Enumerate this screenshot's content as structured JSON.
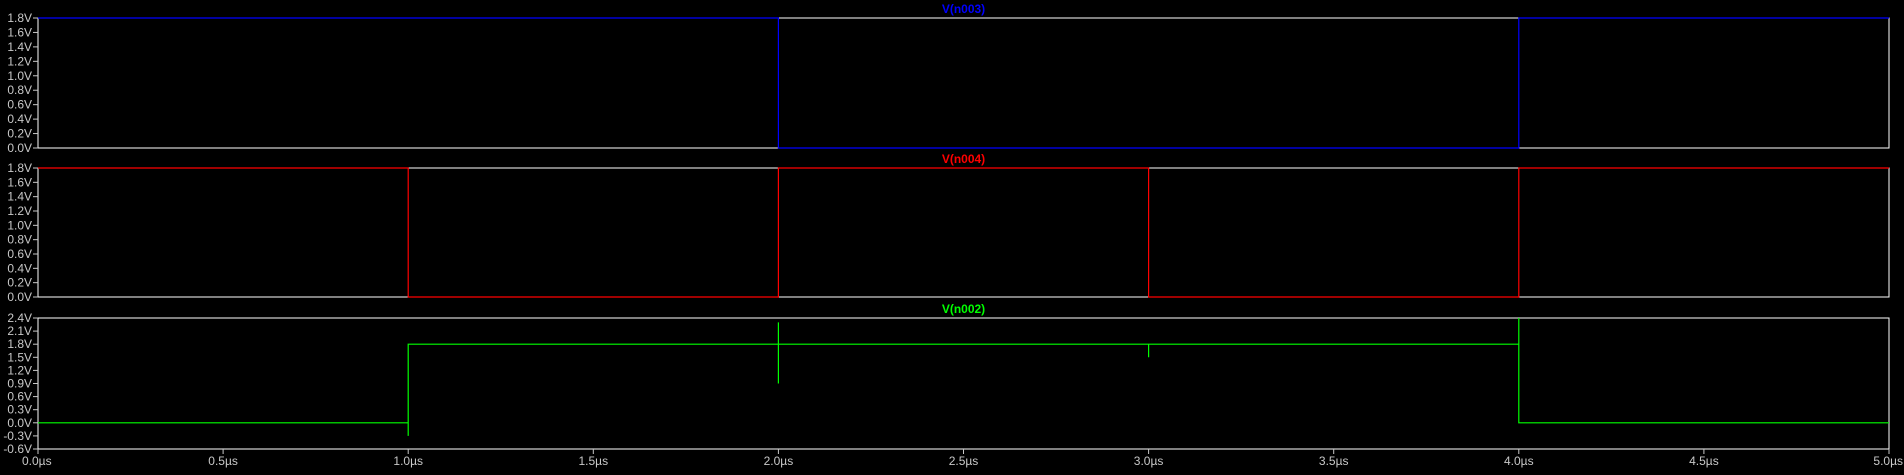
{
  "chart_data": [
    {
      "type": "line",
      "title": "V(n003)",
      "color": "#0000ff",
      "xlim": [
        0,
        5
      ],
      "ylim": [
        0,
        1.8
      ],
      "xunit": "µs",
      "yticks": [
        "0.0V",
        "0.2V",
        "0.4V",
        "0.6V",
        "0.8V",
        "1.0V",
        "1.2V",
        "1.4V",
        "1.6V",
        "1.8V"
      ],
      "x": [
        0,
        2,
        2,
        4,
        4,
        5
      ],
      "y": [
        1.8,
        1.8,
        0,
        0,
        1.8,
        1.8
      ]
    },
    {
      "type": "line",
      "title": "V(n004)",
      "color": "#ff0000",
      "xlim": [
        0,
        5
      ],
      "ylim": [
        0,
        1.8
      ],
      "xunit": "µs",
      "yticks": [
        "0.0V",
        "0.2V",
        "0.4V",
        "0.6V",
        "0.8V",
        "1.0V",
        "1.2V",
        "1.4V",
        "1.6V",
        "1.8V"
      ],
      "x": [
        0,
        1,
        1,
        2,
        2,
        3,
        3,
        4,
        4,
        5
      ],
      "y": [
        1.8,
        1.8,
        0,
        0,
        1.8,
        1.8,
        0,
        0,
        1.8,
        1.8
      ]
    },
    {
      "type": "line",
      "title": "V(n002)",
      "color": "#00ff00",
      "xlim": [
        0,
        5
      ],
      "ylim": [
        -0.6,
        2.4
      ],
      "xunit": "µs",
      "yticks": [
        "-0.6V",
        "-0.3V",
        "0.0V",
        "0.3V",
        "0.6V",
        "0.9V",
        "1.2V",
        "1.5V",
        "1.8V",
        "2.1V",
        "2.4V"
      ],
      "x": [
        0,
        1,
        1,
        1,
        2,
        2,
        2,
        2,
        3,
        3,
        3,
        4,
        4,
        4,
        4,
        5
      ],
      "y": [
        0,
        0,
        -0.3,
        1.8,
        1.8,
        2.3,
        0.9,
        1.8,
        1.8,
        1.5,
        1.8,
        1.8,
        2.4,
        1.8,
        0,
        0
      ]
    }
  ],
  "xaxis": {
    "ticks": [
      "0.0µs",
      "0.5µs",
      "1.0µs",
      "1.5µs",
      "2.0µs",
      "2.5µs",
      "3.0µs",
      "3.5µs",
      "4.0µs",
      "4.5µs",
      "5.0µs"
    ]
  },
  "colors": {
    "background": "#000000",
    "frame": "#ffffff",
    "tick": "#c8c8c8"
  }
}
